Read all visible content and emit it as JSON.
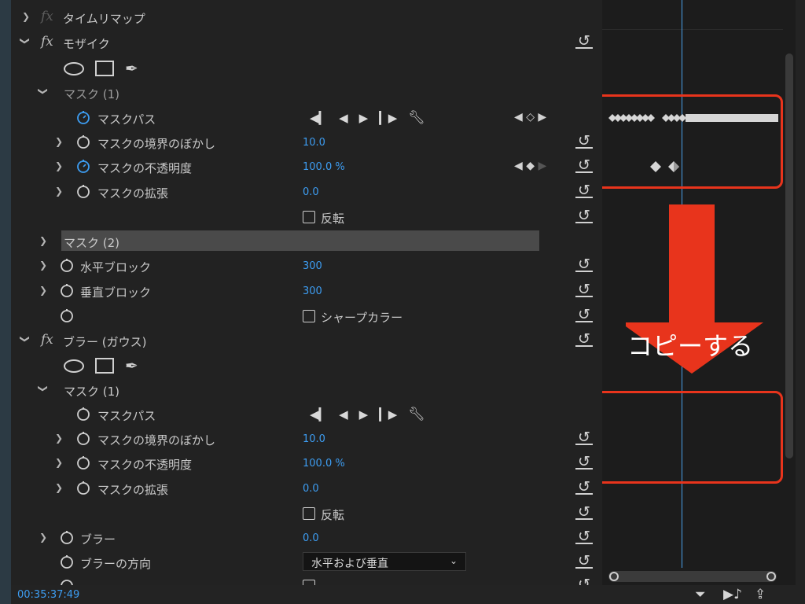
{
  "effects_panel": {
    "time_remap": {
      "label": "タイムリマップ"
    },
    "mosaic": {
      "label": "モザイク",
      "mask1": {
        "label": "マスク (1)",
        "mask_path": "マスクパス",
        "feather": {
          "label": "マスクの境界のぼかし",
          "value": "10.0"
        },
        "opacity": {
          "label": "マスクの不透明度",
          "value": "100.0 %"
        },
        "expansion": {
          "label": "マスクの拡張",
          "value": "0.0"
        },
        "invert": "反転"
      },
      "mask2": {
        "label": "マスク (2)"
      },
      "h_blocks": {
        "label": "水平ブロック",
        "value": "300"
      },
      "v_blocks": {
        "label": "垂直ブロック",
        "value": "300"
      },
      "sharp_colors": "シャープカラー"
    },
    "blur": {
      "label": "ブラー (ガウス)",
      "mask1": {
        "label": "マスク (1)",
        "mask_path": "マスクパス",
        "feather": {
          "label": "マスクの境界のぼかし",
          "value": "10.0"
        },
        "opacity": {
          "label": "マスクの不透明度",
          "value": "100.0 %"
        },
        "expansion": {
          "label": "マスクの拡張",
          "value": "0.0"
        },
        "invert": "反転"
      },
      "blurriness": {
        "label": "ブラー",
        "value": "0.0"
      },
      "direction": {
        "label": "ブラーの方向",
        "value": "水平および垂直"
      }
    }
  },
  "annotation": {
    "text": "コピーする",
    "color": "#e8341c"
  },
  "timecode": "00:35:37:49",
  "colors": {
    "accent": "#3d9df2",
    "highlight": "#e8341c"
  }
}
